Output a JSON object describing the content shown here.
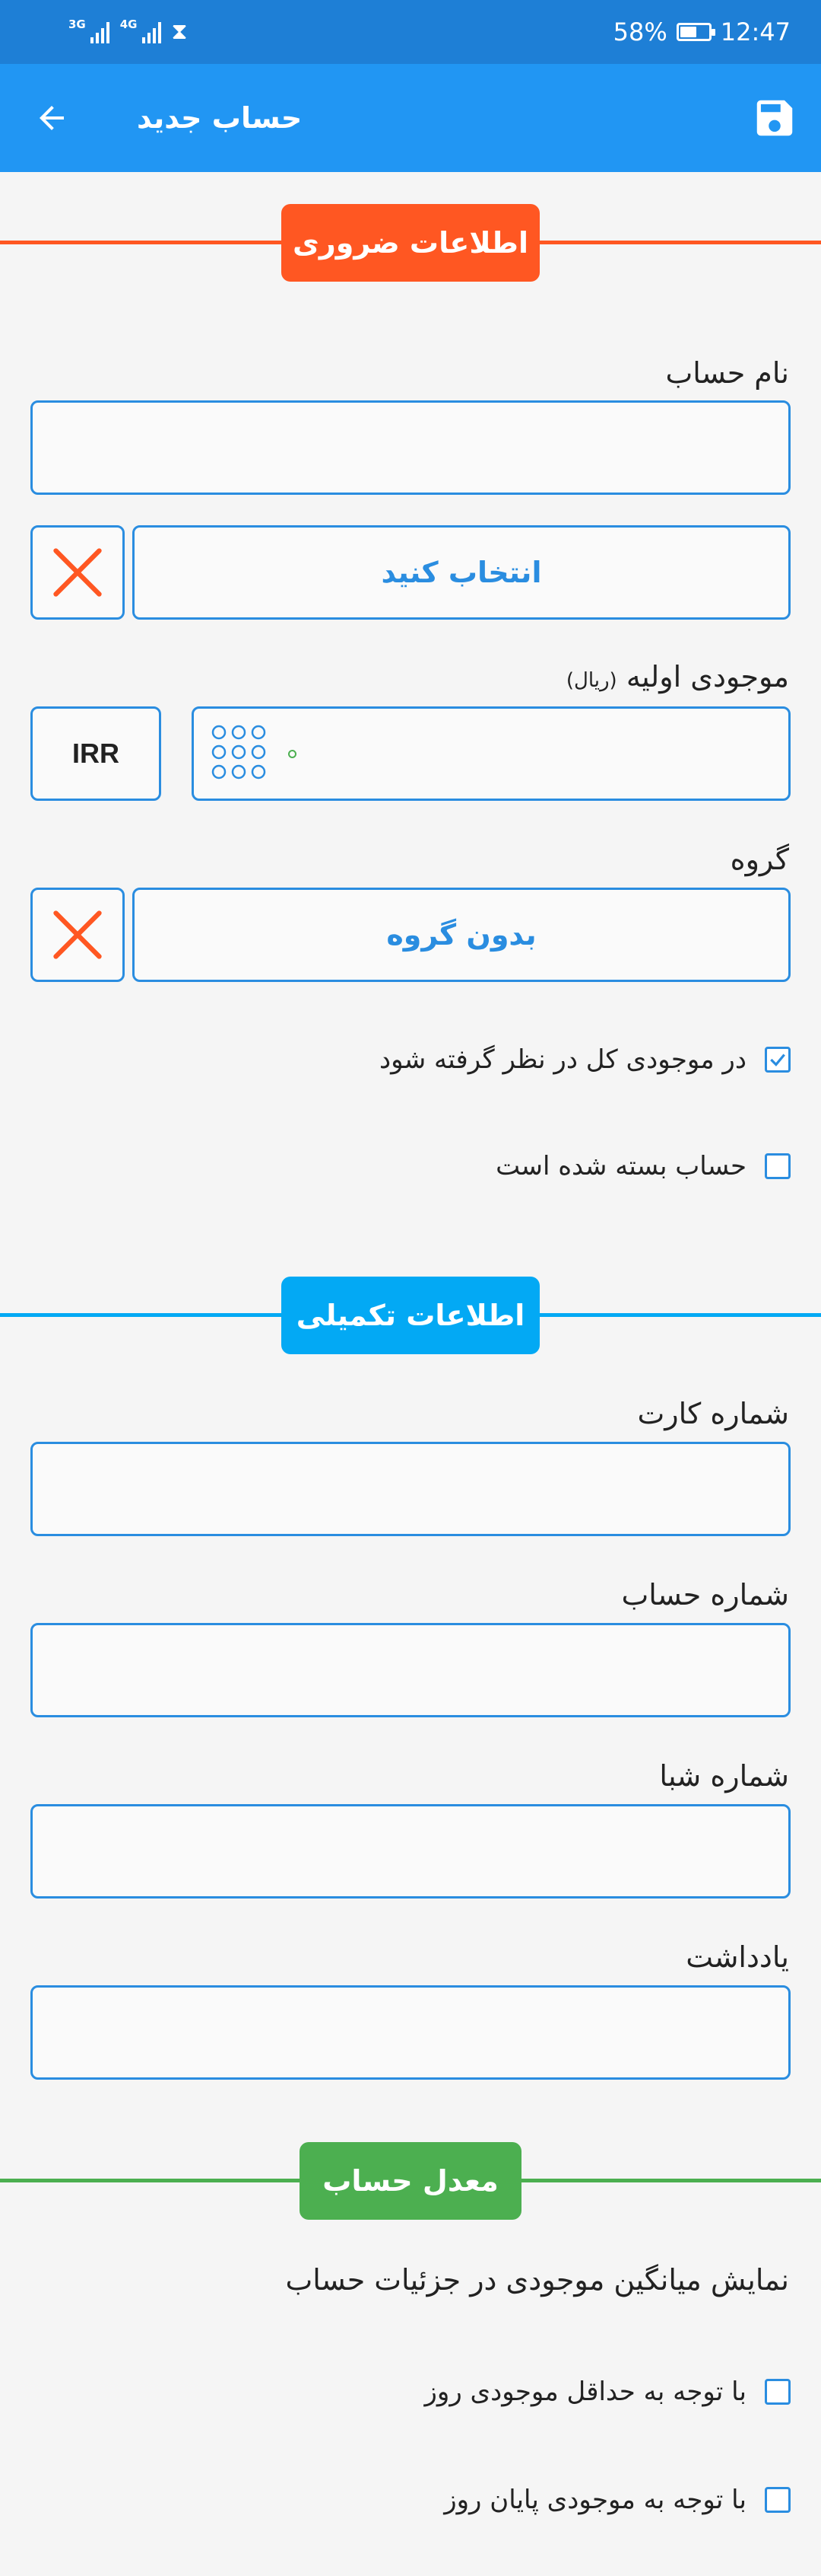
{
  "status_bar": {
    "network_1": "3G",
    "network_2": "4G",
    "battery": "58%",
    "battery_level": 0.58,
    "time": "12:47"
  },
  "app_bar": {
    "title": "حساب جدید",
    "back_icon": "arrow-back-icon",
    "save_icon": "floppy-disk-icon"
  },
  "colors": {
    "primary": "#2196f3",
    "status_bar": "#1e7fd6",
    "required_section": "#ff5722",
    "extra_section": "#03a9f4",
    "average_section": "#4caf50",
    "field_border": "#2a8de0",
    "clear_x": "#ff5722"
  },
  "required_section": {
    "title": "اطلاعات ضروری",
    "account_name_label": "نام حساب",
    "account_name_value": "",
    "select_label": "انتخاب کنید",
    "initial_balance_label": "موجودی اولیه",
    "initial_balance_unit": "(ریال)",
    "initial_balance_value": "",
    "currency": "IRR",
    "group_label": "گروه",
    "group_value": "بدون گروه",
    "include_in_total_label": "در موجودی کل در نظر گرفته شود",
    "include_in_total_checked": true,
    "closed_account_label": "حساب بسته شده است",
    "closed_account_checked": false
  },
  "extra_section": {
    "title": "اطلاعات تکمیلی",
    "card_number_label": "شماره کارت",
    "card_number_value": "",
    "account_number_label": "شماره حساب",
    "account_number_value": "",
    "sheba_label": "شماره شبا",
    "sheba_value": "",
    "note_label": "یادداشت",
    "note_value": ""
  },
  "average_section": {
    "title": "معدل حساب",
    "description": "نمایش میانگین موجودی در جزئیات حساب",
    "min_daily_label": "با توجه به حداقل موجودی روز",
    "min_daily_checked": false,
    "end_of_day_label": "با توجه به موجودی پایان روز",
    "end_of_day_checked": false
  }
}
